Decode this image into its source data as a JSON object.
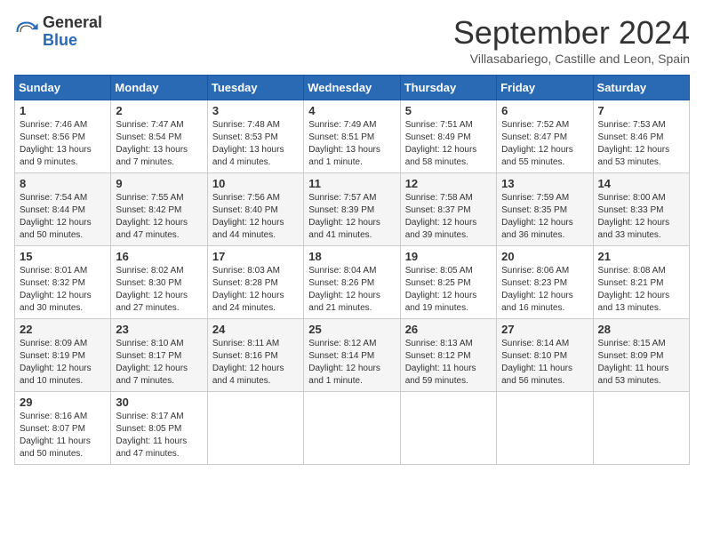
{
  "logo": {
    "general": "General",
    "blue": "Blue"
  },
  "title": "September 2024",
  "subtitle": "Villasabariego, Castille and Leon, Spain",
  "days_header": [
    "Sunday",
    "Monday",
    "Tuesday",
    "Wednesday",
    "Thursday",
    "Friday",
    "Saturday"
  ],
  "weeks": [
    [
      {
        "day": "1",
        "info": "Sunrise: 7:46 AM\nSunset: 8:56 PM\nDaylight: 13 hours\nand 9 minutes."
      },
      {
        "day": "2",
        "info": "Sunrise: 7:47 AM\nSunset: 8:54 PM\nDaylight: 13 hours\nand 7 minutes."
      },
      {
        "day": "3",
        "info": "Sunrise: 7:48 AM\nSunset: 8:53 PM\nDaylight: 13 hours\nand 4 minutes."
      },
      {
        "day": "4",
        "info": "Sunrise: 7:49 AM\nSunset: 8:51 PM\nDaylight: 13 hours\nand 1 minute."
      },
      {
        "day": "5",
        "info": "Sunrise: 7:51 AM\nSunset: 8:49 PM\nDaylight: 12 hours\nand 58 minutes."
      },
      {
        "day": "6",
        "info": "Sunrise: 7:52 AM\nSunset: 8:47 PM\nDaylight: 12 hours\nand 55 minutes."
      },
      {
        "day": "7",
        "info": "Sunrise: 7:53 AM\nSunset: 8:46 PM\nDaylight: 12 hours\nand 53 minutes."
      }
    ],
    [
      {
        "day": "8",
        "info": "Sunrise: 7:54 AM\nSunset: 8:44 PM\nDaylight: 12 hours\nand 50 minutes."
      },
      {
        "day": "9",
        "info": "Sunrise: 7:55 AM\nSunset: 8:42 PM\nDaylight: 12 hours\nand 47 minutes."
      },
      {
        "day": "10",
        "info": "Sunrise: 7:56 AM\nSunset: 8:40 PM\nDaylight: 12 hours\nand 44 minutes."
      },
      {
        "day": "11",
        "info": "Sunrise: 7:57 AM\nSunset: 8:39 PM\nDaylight: 12 hours\nand 41 minutes."
      },
      {
        "day": "12",
        "info": "Sunrise: 7:58 AM\nSunset: 8:37 PM\nDaylight: 12 hours\nand 39 minutes."
      },
      {
        "day": "13",
        "info": "Sunrise: 7:59 AM\nSunset: 8:35 PM\nDaylight: 12 hours\nand 36 minutes."
      },
      {
        "day": "14",
        "info": "Sunrise: 8:00 AM\nSunset: 8:33 PM\nDaylight: 12 hours\nand 33 minutes."
      }
    ],
    [
      {
        "day": "15",
        "info": "Sunrise: 8:01 AM\nSunset: 8:32 PM\nDaylight: 12 hours\nand 30 minutes."
      },
      {
        "day": "16",
        "info": "Sunrise: 8:02 AM\nSunset: 8:30 PM\nDaylight: 12 hours\nand 27 minutes."
      },
      {
        "day": "17",
        "info": "Sunrise: 8:03 AM\nSunset: 8:28 PM\nDaylight: 12 hours\nand 24 minutes."
      },
      {
        "day": "18",
        "info": "Sunrise: 8:04 AM\nSunset: 8:26 PM\nDaylight: 12 hours\nand 21 minutes."
      },
      {
        "day": "19",
        "info": "Sunrise: 8:05 AM\nSunset: 8:25 PM\nDaylight: 12 hours\nand 19 minutes."
      },
      {
        "day": "20",
        "info": "Sunrise: 8:06 AM\nSunset: 8:23 PM\nDaylight: 12 hours\nand 16 minutes."
      },
      {
        "day": "21",
        "info": "Sunrise: 8:08 AM\nSunset: 8:21 PM\nDaylight: 12 hours\nand 13 minutes."
      }
    ],
    [
      {
        "day": "22",
        "info": "Sunrise: 8:09 AM\nSunset: 8:19 PM\nDaylight: 12 hours\nand 10 minutes."
      },
      {
        "day": "23",
        "info": "Sunrise: 8:10 AM\nSunset: 8:17 PM\nDaylight: 12 hours\nand 7 minutes."
      },
      {
        "day": "24",
        "info": "Sunrise: 8:11 AM\nSunset: 8:16 PM\nDaylight: 12 hours\nand 4 minutes."
      },
      {
        "day": "25",
        "info": "Sunrise: 8:12 AM\nSunset: 8:14 PM\nDaylight: 12 hours\nand 1 minute."
      },
      {
        "day": "26",
        "info": "Sunrise: 8:13 AM\nSunset: 8:12 PM\nDaylight: 11 hours\nand 59 minutes."
      },
      {
        "day": "27",
        "info": "Sunrise: 8:14 AM\nSunset: 8:10 PM\nDaylight: 11 hours\nand 56 minutes."
      },
      {
        "day": "28",
        "info": "Sunrise: 8:15 AM\nSunset: 8:09 PM\nDaylight: 11 hours\nand 53 minutes."
      }
    ],
    [
      {
        "day": "29",
        "info": "Sunrise: 8:16 AM\nSunset: 8:07 PM\nDaylight: 11 hours\nand 50 minutes."
      },
      {
        "day": "30",
        "info": "Sunrise: 8:17 AM\nSunset: 8:05 PM\nDaylight: 11 hours\nand 47 minutes."
      },
      null,
      null,
      null,
      null,
      null
    ]
  ]
}
